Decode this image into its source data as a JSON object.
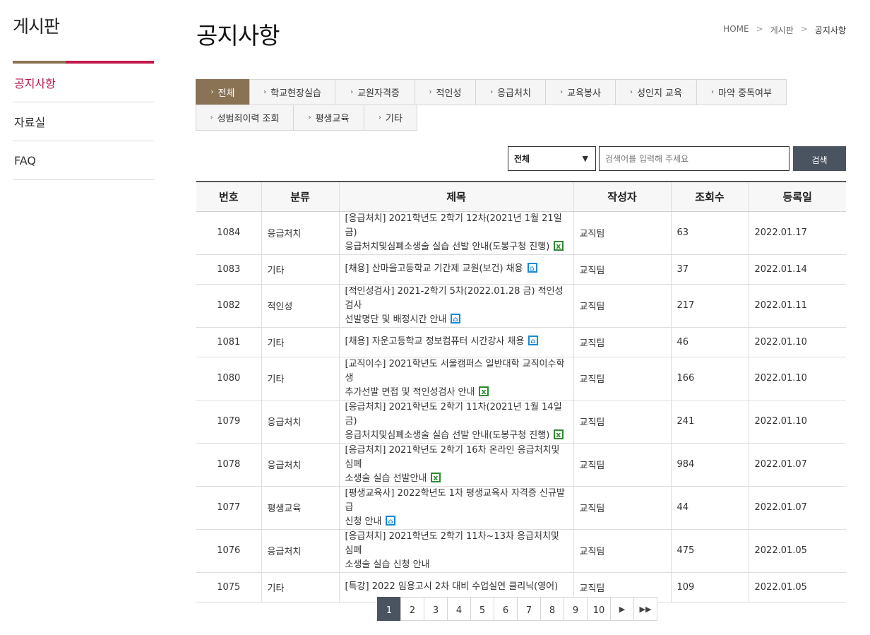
{
  "sidebar": {
    "title": "게시판",
    "items": [
      {
        "label": "공지사항",
        "active": true
      },
      {
        "label": "자료실",
        "active": false
      },
      {
        "label": "FAQ",
        "active": false
      }
    ]
  },
  "header": {
    "title": "공지사항",
    "breadcrumb": [
      "HOME",
      "게시판",
      "공지사항"
    ],
    "breadcrumb_sep": ">"
  },
  "tabs": {
    "row1": [
      {
        "label": "전체",
        "active": true,
        "w": 77
      },
      {
        "label": "학교현장실습",
        "w": 122
      },
      {
        "label": "교원자격증",
        "w": 114
      },
      {
        "label": "적인성",
        "w": 87
      },
      {
        "label": "응급처치",
        "w": 100
      },
      {
        "label": "교육봉사",
        "w": 100
      },
      {
        "label": "성인지 교육",
        "w": 116
      },
      {
        "label": "마약 중독여부",
        "w": 128
      }
    ],
    "row2": [
      {
        "label": "성범죄이력 조회",
        "w": 139
      },
      {
        "label": "평생교육",
        "w": 101
      },
      {
        "label": "기타",
        "w": 76
      }
    ]
  },
  "search": {
    "select_value": "전체",
    "placeholder": "검색어를 입력해 주세요",
    "button_label": "검색"
  },
  "table": {
    "headers": [
      "번호",
      "분류",
      "제목",
      "작성자",
      "조회수",
      "등록일"
    ],
    "rows": [
      {
        "no": "1084",
        "cat": "응급처치",
        "title1": "[응급처치] 2021학년도 2학기 12차(2021년 1월 21일 금)",
        "title2": "응급처치및심폐소생술 실습 선발 안내(도봉구청 진행)",
        "icon": "xls",
        "author": "교직팀",
        "views": "63",
        "date": "2022.01.17"
      },
      {
        "no": "1083",
        "cat": "기타",
        "title1": "[채용] 산마을고등학교 기간제 교원(보건) 채용",
        "title2": "",
        "icon": "hwp",
        "author": "교직팀",
        "views": "37",
        "date": "2022.01.14"
      },
      {
        "no": "1082",
        "cat": "적인성",
        "title1": "[적인성검사] 2021-2학기 5차(2022.01.28 금) 적인성검사",
        "title2": "선발명단 및 배정시간 안내",
        "icon": "hwp",
        "author": "교직팀",
        "views": "217",
        "date": "2022.01.11"
      },
      {
        "no": "1081",
        "cat": "기타",
        "title1": "[채용] 자운고등학교 정보컴퓨터 시간강사 채용",
        "title2": "",
        "icon": "hwp",
        "author": "교직팀",
        "views": "46",
        "date": "2022.01.10"
      },
      {
        "no": "1080",
        "cat": "기타",
        "title1": "[교직이수] 2021학년도 서울캠퍼스 일반대학 교직이수학생",
        "title2": "추가선발 면접 및 적인성검사 안내",
        "icon": "xls",
        "author": "교직팀",
        "views": "166",
        "date": "2022.01.10"
      },
      {
        "no": "1079",
        "cat": "응급처치",
        "title1": "[응급처치] 2021학년도 2학기 11차(2021년 1월 14일 금)",
        "title2": "응급처치및심폐소생술 실습 선발 안내(도봉구청 진행)",
        "icon": "xls",
        "author": "교직팀",
        "views": "241",
        "date": "2022.01.10"
      },
      {
        "no": "1078",
        "cat": "응급처치",
        "title1": "[응급처치] 2021학년도 2학기 16차 온라인 응급처치및심폐",
        "title2": "소생술 실습 선발안내",
        "icon": "xls",
        "author": "교직팀",
        "views": "984",
        "date": "2022.01.07"
      },
      {
        "no": "1077",
        "cat": "평생교육",
        "title1": "[평생교육사] 2022학년도 1차 평생교육사 자격증 신규발급",
        "title2": "신청 안내",
        "icon": "hwp",
        "author": "교직팀",
        "views": "44",
        "date": "2022.01.07"
      },
      {
        "no": "1076",
        "cat": "응급처치",
        "title1": "[응급처치] 2021학년도 2학기 11차~13차 응급처치및심폐",
        "title2": "소생술 실습 신청 안내",
        "icon": "",
        "author": "교직팀",
        "views": "475",
        "date": "2022.01.05"
      },
      {
        "no": "1075",
        "cat": "기타",
        "title1": "[특강] 2022 임용고시 2차 대비 수업실연 클리닉(영어)",
        "title2": "",
        "icon": "",
        "author": "교직팀",
        "views": "109",
        "date": "2022.01.05"
      }
    ]
  },
  "pagination": {
    "pages": [
      "1",
      "2",
      "3",
      "4",
      "5",
      "6",
      "7",
      "8",
      "9",
      "10"
    ],
    "current": "1",
    "next": "▶",
    "last": "▶▶"
  }
}
